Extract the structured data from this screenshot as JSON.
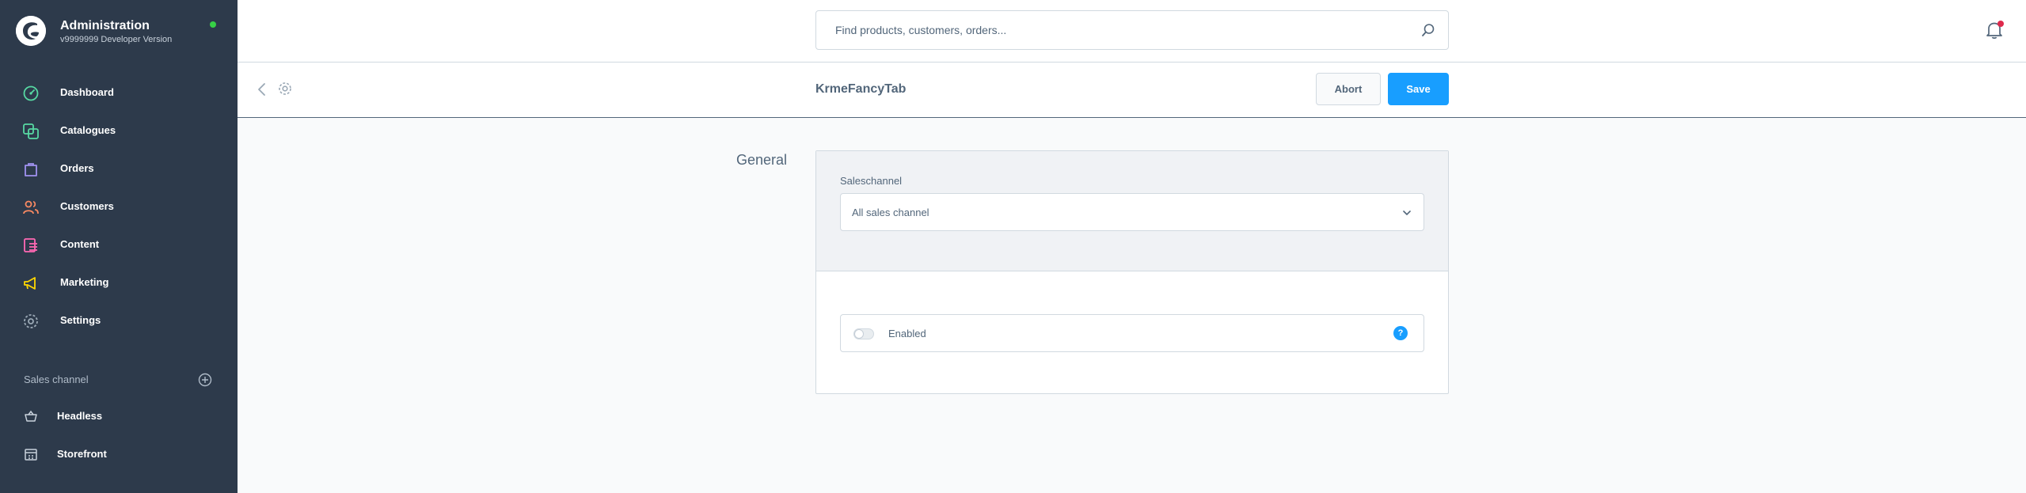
{
  "brand": {
    "title": "Administration",
    "version": "v9999999 Developer Version",
    "status_color": "#37d046"
  },
  "sidebar": {
    "items": [
      {
        "label": "Dashboard",
        "icon": "dashboard-icon",
        "color": "#57d9a3"
      },
      {
        "label": "Catalogues",
        "icon": "catalogue-icon",
        "color": "#57d9a3"
      },
      {
        "label": "Orders",
        "icon": "orders-icon",
        "color": "#a092f0"
      },
      {
        "label": "Customers",
        "icon": "customers-icon",
        "color": "#f88962"
      },
      {
        "label": "Content",
        "icon": "content-icon",
        "color": "#ff68b4"
      },
      {
        "label": "Marketing",
        "icon": "marketing-icon",
        "color": "#ffd700"
      },
      {
        "label": "Settings",
        "icon": "settings-icon",
        "color": "#9aa8b5"
      }
    ],
    "sales_channel": {
      "title": "Sales channel",
      "items": [
        {
          "label": "Headless",
          "icon": "basket-icon"
        },
        {
          "label": "Storefront",
          "icon": "storefront-icon"
        }
      ]
    }
  },
  "search": {
    "placeholder": "Find products, customers, orders..."
  },
  "smartbar": {
    "title": "KrmeFancyTab",
    "abort_label": "Abort",
    "save_label": "Save"
  },
  "main": {
    "section_label": "General",
    "saleschannel_label": "Saleschannel",
    "saleschannel_value": "All sales channel",
    "enabled_label": "Enabled",
    "enabled": false
  },
  "colors": {
    "accent": "#189eff",
    "sidebar_bg": "#2d3a4b",
    "notification": "#de294c"
  }
}
